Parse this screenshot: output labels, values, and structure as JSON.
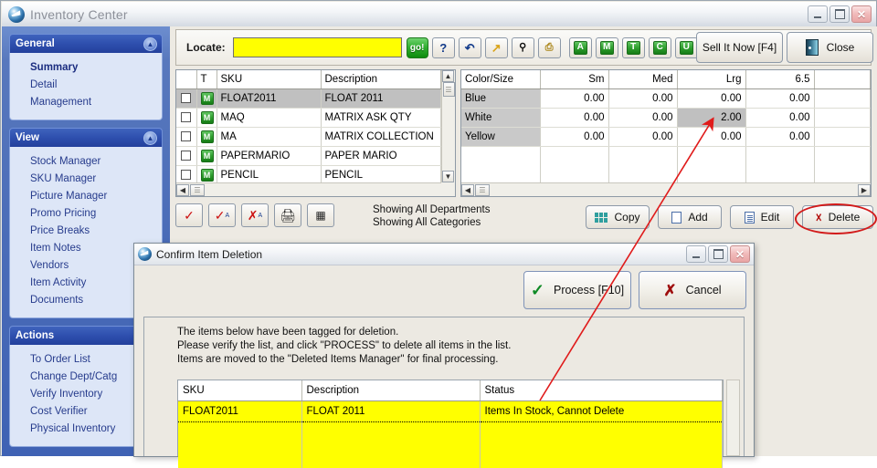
{
  "window": {
    "title": "Inventory Center",
    "logo_icon": "app-logo-icon",
    "controls": {
      "minimize": "–",
      "maximize": "□",
      "close": "✕"
    }
  },
  "sidebar": {
    "groups": [
      {
        "title": "General",
        "collapse_icon": "chevron-up-icon",
        "items": [
          {
            "label": "Summary",
            "active": true
          },
          {
            "label": "Detail",
            "active": false
          },
          {
            "label": "Management",
            "active": false
          }
        ]
      },
      {
        "title": "View",
        "collapse_icon": "chevron-up-icon",
        "items": [
          {
            "label": "Stock Manager",
            "active": false
          },
          {
            "label": "SKU Manager",
            "active": false
          },
          {
            "label": "Picture Manager",
            "active": false
          },
          {
            "label": "Promo Pricing",
            "active": false
          },
          {
            "label": "Price Breaks",
            "active": false
          },
          {
            "label": "Item Notes",
            "active": false
          },
          {
            "label": "Vendors",
            "active": false
          },
          {
            "label": "Item Activity",
            "active": false
          },
          {
            "label": "Documents",
            "active": false
          }
        ]
      },
      {
        "title": "Actions",
        "collapse_icon": "chevron-up-icon",
        "items": [
          {
            "label": "To Order List",
            "active": false
          },
          {
            "label": "Change Dept/Catg",
            "active": false
          },
          {
            "label": "Verify Inventory",
            "active": false
          },
          {
            "label": "Cost Verifier",
            "active": false
          },
          {
            "label": "Physical Inventory",
            "active": false
          }
        ]
      }
    ]
  },
  "toolbar": {
    "locate_label": "Locate:",
    "locate_value": "",
    "locate_placeholder": "",
    "go_label": "go!",
    "icon_buttons": [
      {
        "name": "help-icon",
        "glyph": "?"
      },
      {
        "name": "refresh-icon",
        "glyph": "↺"
      },
      {
        "name": "jump-arrow-icon",
        "glyph": "↗"
      },
      {
        "name": "binoculars-icon",
        "glyph": "◉◉"
      },
      {
        "name": "preview-icon",
        "glyph": "🔍"
      }
    ],
    "flag_buttons": [
      {
        "name": "flag-a",
        "label": "A"
      },
      {
        "name": "flag-m",
        "label": "M"
      },
      {
        "name": "flag-t",
        "label": "T"
      },
      {
        "name": "flag-c",
        "label": "C"
      },
      {
        "name": "flag-u",
        "label": "U"
      }
    ],
    "sell_it_now_label": "Sell It Now [F4]",
    "close_label": "Close",
    "close_icon": "exit-door-icon"
  },
  "item_grid": {
    "columns": [
      "",
      "T",
      "SKU",
      "Description"
    ],
    "rows": [
      {
        "checked": false,
        "type": "M",
        "sku": "FLOAT2011",
        "description": "FLOAT 2011",
        "selected": true
      },
      {
        "checked": false,
        "type": "M",
        "sku": "MAQ",
        "description": "MATRIX ASK QTY",
        "selected": false
      },
      {
        "checked": false,
        "type": "M",
        "sku": "MA",
        "description": "MATRIX COLLECTION",
        "selected": false
      },
      {
        "checked": false,
        "type": "M",
        "sku": "PAPERMARIO",
        "description": "PAPER MARIO",
        "selected": false
      },
      {
        "checked": false,
        "type": "M",
        "sku": "PENCIL",
        "description": "PENCIL",
        "selected": false
      }
    ]
  },
  "matrix_grid": {
    "columns": [
      "Color/Size",
      "Sm",
      "Med",
      "Lrg",
      "6.5"
    ],
    "rows": [
      {
        "label": "Blue",
        "values": [
          "0.00",
          "0.00",
          "0.00",
          "0.00"
        ],
        "highlight_index": -1
      },
      {
        "label": "White",
        "values": [
          "0.00",
          "0.00",
          "2.00",
          "0.00"
        ],
        "highlight_index": 2
      },
      {
        "label": "Yellow",
        "values": [
          "0.00",
          "0.00",
          "0.00",
          "0.00"
        ],
        "highlight_index": -1
      }
    ]
  },
  "action_row": {
    "left_icon_buttons": [
      {
        "name": "check-all-icon",
        "glyph": "✓"
      },
      {
        "name": "check-all-a-icon",
        "glyph": "✓"
      },
      {
        "name": "uncheck-all-a-icon",
        "glyph": "✗"
      },
      {
        "name": "print-icon",
        "glyph": "🖶"
      },
      {
        "name": "list-icon",
        "glyph": "▤"
      }
    ],
    "status_line1": "Showing All Departments",
    "status_line2": "Showing All Categories",
    "buttons": [
      {
        "name": "copy-button",
        "label": "Copy",
        "icon": "copy-grid-icon"
      },
      {
        "name": "add-button",
        "label": "Add",
        "icon": "new-document-icon"
      },
      {
        "name": "edit-button",
        "label": "Edit",
        "icon": "document-lines-icon"
      },
      {
        "name": "delete-button",
        "label": "Delete",
        "icon": "red-x-icon",
        "highlighted": true
      }
    ]
  },
  "dialog": {
    "title": "Confirm Item Deletion",
    "controls": {
      "minimize": "–",
      "maximize": "□",
      "close": "✕"
    },
    "process_label": "Process [F10]",
    "process_icon": "green-check-icon",
    "cancel_label": "Cancel",
    "cancel_icon": "red-x-icon",
    "message_lines": [
      "The items below have been tagged for deletion.",
      "Please verify the list, and click \"PROCESS\" to delete all items in the list.",
      "Items are moved to the \"Deleted Items Manager\" for final processing."
    ],
    "table": {
      "columns": [
        "SKU",
        "Description",
        "Status"
      ],
      "rows": [
        {
          "sku": "FLOAT2011",
          "description": "FLOAT 2011",
          "status": "Items In Stock, Cannot Delete"
        }
      ]
    }
  },
  "annotation": {
    "arrow_color": "#e01b1b",
    "ellipse_color": "#d21b1b"
  }
}
